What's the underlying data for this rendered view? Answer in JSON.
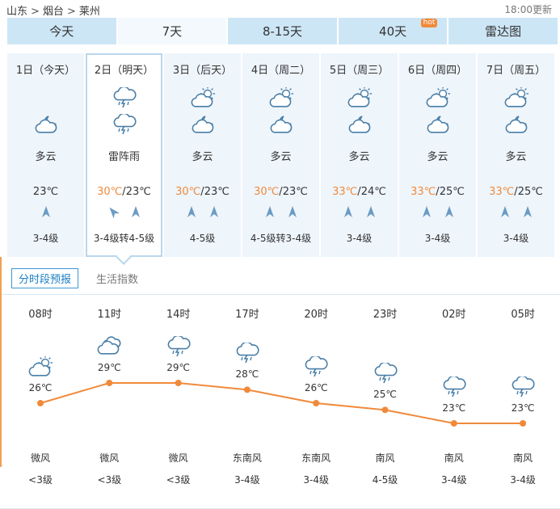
{
  "breadcrumb": {
    "province": "山东",
    "city": "烟台",
    "district": "莱州"
  },
  "update_time": "18:00更新",
  "tabs": [
    {
      "label": "今天",
      "active": false,
      "hot": false
    },
    {
      "label": "7天",
      "active": true,
      "hot": false
    },
    {
      "label": "8-15天",
      "active": false,
      "hot": false
    },
    {
      "label": "40天",
      "active": false,
      "hot": true
    },
    {
      "label": "雷达图",
      "active": false,
      "hot": false
    }
  ],
  "hot_label": "hot",
  "days": [
    {
      "name": "1日（今天）",
      "icon_am": "",
      "icon_pm": "cloudy-night-icon",
      "desc": "多云",
      "hi": "",
      "lo": "23℃",
      "winds": [
        "n"
      ],
      "level": "3-4级",
      "selected": false
    },
    {
      "name": "2日（明天）",
      "icon_am": "thunderstorm-icon",
      "icon_pm": "thunderstorm-icon",
      "desc": "雷阵雨",
      "hi": "30℃",
      "lo": "23℃",
      "winds": [
        "nw",
        "n"
      ],
      "level": "3-4级转4-5级",
      "selected": true
    },
    {
      "name": "3日（后天）",
      "icon_am": "partly-cloudy-day-icon",
      "icon_pm": "cloudy-night-icon",
      "desc": "多云",
      "hi": "30℃",
      "lo": "23℃",
      "winds": [
        "n",
        "n"
      ],
      "level": "4-5级",
      "selected": false
    },
    {
      "name": "4日（周二）",
      "icon_am": "partly-cloudy-day-icon",
      "icon_pm": "cloudy-night-icon",
      "desc": "多云",
      "hi": "30℃",
      "lo": "23℃",
      "winds": [
        "n",
        "n"
      ],
      "level": "4-5级转3-4级",
      "selected": false
    },
    {
      "name": "5日（周三）",
      "icon_am": "partly-cloudy-day-icon",
      "icon_pm": "cloudy-night-icon",
      "desc": "多云",
      "hi": "33℃",
      "lo": "24℃",
      "winds": [
        "n",
        "n"
      ],
      "level": "3-4级",
      "selected": false
    },
    {
      "name": "6日（周四）",
      "icon_am": "partly-cloudy-day-icon",
      "icon_pm": "cloudy-night-icon",
      "desc": "多云",
      "hi": "33℃",
      "lo": "25℃",
      "winds": [
        "n",
        "n"
      ],
      "level": "3-4级",
      "selected": false
    },
    {
      "name": "7日（周五）",
      "icon_am": "partly-cloudy-day-icon",
      "icon_pm": "cloudy-night-icon",
      "desc": "多云",
      "hi": "33℃",
      "lo": "25℃",
      "winds": [
        "n",
        "n"
      ],
      "level": "3-4级",
      "selected": false
    }
  ],
  "subtabs": [
    {
      "label": "分时段预报",
      "active": true
    },
    {
      "label": "生活指数",
      "active": false
    }
  ],
  "hourly": [
    {
      "time": "08时",
      "icon": "partly-cloudy-day-icon",
      "temp": 26,
      "temp_label": "26℃",
      "wind": "微风",
      "level": "<3级"
    },
    {
      "time": "11时",
      "icon": "overcast-icon",
      "temp": 29,
      "temp_label": "29℃",
      "wind": "微风",
      "level": "<3级"
    },
    {
      "time": "14时",
      "icon": "thunderstorm-icon",
      "temp": 29,
      "temp_label": "29℃",
      "wind": "微风",
      "level": "<3级"
    },
    {
      "time": "17时",
      "icon": "thunderstorm-icon",
      "temp": 28,
      "temp_label": "28℃",
      "wind": "东南风",
      "level": "3-4级"
    },
    {
      "time": "20时",
      "icon": "thunderstorm-icon",
      "temp": 26,
      "temp_label": "26℃",
      "wind": "东南风",
      "level": "3-4级"
    },
    {
      "time": "23时",
      "icon": "thunderstorm-icon",
      "temp": 25,
      "temp_label": "25℃",
      "wind": "南风",
      "level": "4-5级"
    },
    {
      "time": "02时",
      "icon": "thunderstorm-icon",
      "temp": 23,
      "temp_label": "23℃",
      "wind": "南风",
      "level": "3-4级"
    },
    {
      "time": "05时",
      "icon": "thunderstorm-icon",
      "temp": 23,
      "temp_label": "23℃",
      "wind": "南风",
      "level": "3-4级"
    }
  ],
  "colors": {
    "accent": "#f08a3b",
    "tab_bg": "#cde6f6",
    "card_bg": "#eef5fb",
    "icon_blue": "#4a7fa8",
    "selected_border": "#b8d6ec"
  }
}
